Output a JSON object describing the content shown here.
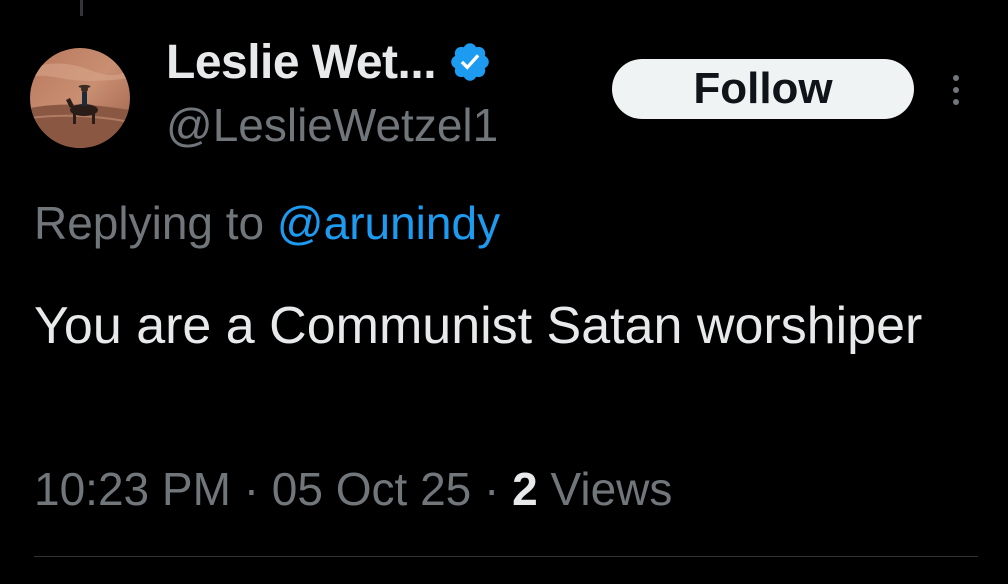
{
  "tweet": {
    "author": {
      "display_name": "Leslie Wet...",
      "handle": "@LeslieWetzel1",
      "verified": true,
      "avatar_icon": "avatar-rider-on-horse-canyon"
    },
    "follow_label": "Follow",
    "more_icon": "more-vertical-icon",
    "replying_prefix": "Replying to ",
    "replying_mention": "@arunindy",
    "text": "You are a Communist Satan worshiper",
    "time": "10:23 PM",
    "separator": "·",
    "date": "05 Oct 25",
    "views_count": "2",
    "views_label": "Views"
  },
  "colors": {
    "background": "#000000",
    "primary_text": "#e7e9ea",
    "secondary_text": "#71767b",
    "accent": "#1d9bf0",
    "follow_bg": "#eff3f4",
    "follow_text": "#0f1419"
  }
}
